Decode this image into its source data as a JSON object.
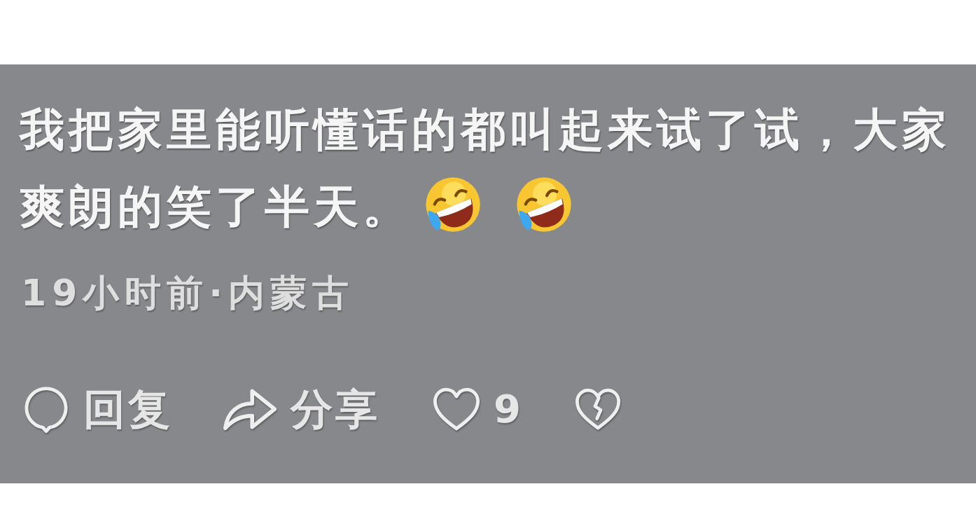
{
  "comment": {
    "lines": [
      "我把家里能听懂话的都叫起来试了试，大家",
      "爽朗的笑了半天。"
    ],
    "emojis": [
      {
        "kind": "laughing-tears"
      },
      {
        "kind": "laughing-tears"
      }
    ],
    "meta": "19小时前·内蒙古",
    "actions": [
      {
        "kind": "reply",
        "label": "回复"
      },
      {
        "kind": "share",
        "label": "分享"
      },
      {
        "kind": "like",
        "label": "9"
      },
      {
        "kind": "dislike"
      }
    ]
  }
}
